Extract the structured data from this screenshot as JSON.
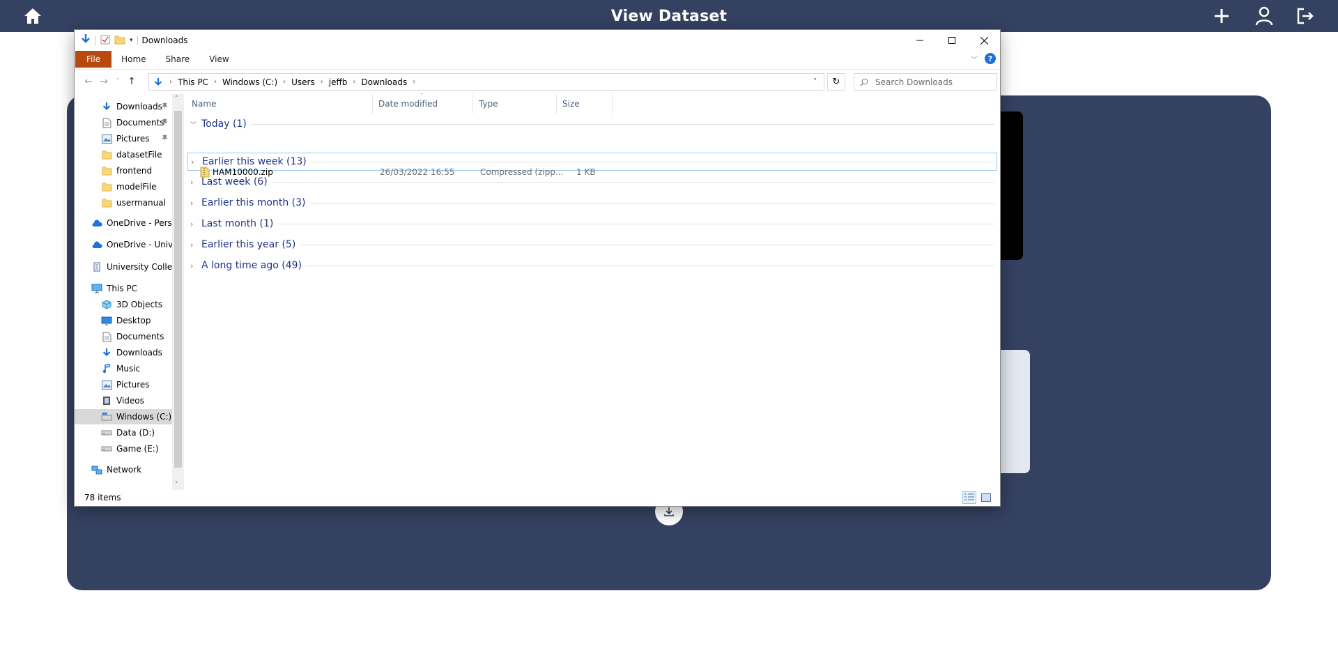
{
  "app": {
    "title": "View Dataset",
    "icons": [
      "home-icon",
      "plus-icon",
      "user-icon",
      "logout-icon"
    ],
    "colors": {
      "header": "#344161",
      "panel": "#344161"
    }
  },
  "explorer": {
    "window_title": "Downloads",
    "ribbon_tabs": [
      "File",
      "Home",
      "Share",
      "View"
    ],
    "breadcrumb": [
      "This PC",
      "Windows (C:)",
      "Users",
      "jeffb",
      "Downloads"
    ],
    "search_placeholder": "Search Downloads",
    "nav_items": [
      {
        "label": "Downloads",
        "icon": "download-arrow-icon",
        "pinned": true
      },
      {
        "label": "Documents",
        "icon": "document-icon",
        "pinned": true
      },
      {
        "label": "Pictures",
        "icon": "pictures-icon",
        "pinned": true
      },
      {
        "label": "datasetFile",
        "icon": "folder-icon"
      },
      {
        "label": "frontend",
        "icon": "folder-icon"
      },
      {
        "label": "modelFile",
        "icon": "folder-icon"
      },
      {
        "label": "usermanual",
        "icon": "folder-icon"
      },
      {
        "label": "OneDrive - Persor",
        "icon": "cloud-icon"
      },
      {
        "label": "OneDrive - Univer",
        "icon": "cloud-icon"
      },
      {
        "label": "University College",
        "icon": "building-icon"
      },
      {
        "label": "This PC",
        "icon": "computer-icon"
      },
      {
        "label": "3D Objects",
        "icon": "cube-icon"
      },
      {
        "label": "Desktop",
        "icon": "desktop-icon"
      },
      {
        "label": "Documents",
        "icon": "document-icon"
      },
      {
        "label": "Downloads",
        "icon": "download-arrow-icon"
      },
      {
        "label": "Music",
        "icon": "music-note-icon"
      },
      {
        "label": "Pictures",
        "icon": "pictures-icon"
      },
      {
        "label": "Videos",
        "icon": "film-icon"
      },
      {
        "label": "Windows (C:)",
        "icon": "windows-drive-icon",
        "selected": true
      },
      {
        "label": "Data (D:)",
        "icon": "drive-icon"
      },
      {
        "label": "Game (E:)",
        "icon": "drive-icon"
      },
      {
        "label": "Network",
        "icon": "network-icon"
      }
    ],
    "columns": [
      "Name",
      "Date modified",
      "Type",
      "Size"
    ],
    "groups": [
      {
        "label": "Today (1)",
        "expanded": true
      },
      {
        "label": "Earlier this week (13)",
        "expanded": false,
        "focused": true
      },
      {
        "label": "Last week (6)",
        "expanded": false
      },
      {
        "label": "Earlier this month (3)",
        "expanded": false
      },
      {
        "label": "Last month (1)",
        "expanded": false
      },
      {
        "label": "Earlier this year (5)",
        "expanded": false
      },
      {
        "label": "A long time ago (49)",
        "expanded": false
      }
    ],
    "files": [
      {
        "name": "HAM10000.zip",
        "date": "26/03/2022 16:55",
        "type": "Compressed (zipp...",
        "size": "1 KB"
      }
    ],
    "status": "78 items"
  }
}
